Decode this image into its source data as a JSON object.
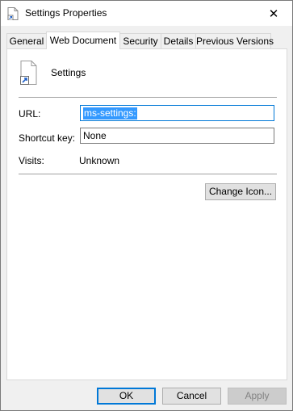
{
  "window": {
    "title": "Settings Properties",
    "close_glyph": "✕"
  },
  "tabs": [
    {
      "label": "General"
    },
    {
      "label": "Web Document"
    },
    {
      "label": "Security"
    },
    {
      "label": "Details"
    },
    {
      "label": "Previous Versions"
    }
  ],
  "active_tab": "Web Document",
  "file": {
    "name": "Settings",
    "icon": "shortcut-document-icon"
  },
  "form": {
    "url_label": "URL:",
    "url_value": "ms-settings:",
    "shortcut_label": "Shortcut key:",
    "shortcut_value": "None",
    "visits_label": "Visits:",
    "visits_value": "Unknown"
  },
  "buttons": {
    "change_icon": "Change Icon...",
    "ok": "OK",
    "cancel": "Cancel",
    "apply": "Apply"
  },
  "colors": {
    "selection": "#3399ff",
    "focus_border": "#0078d7",
    "dialog_bg": "#f0f0f0"
  }
}
